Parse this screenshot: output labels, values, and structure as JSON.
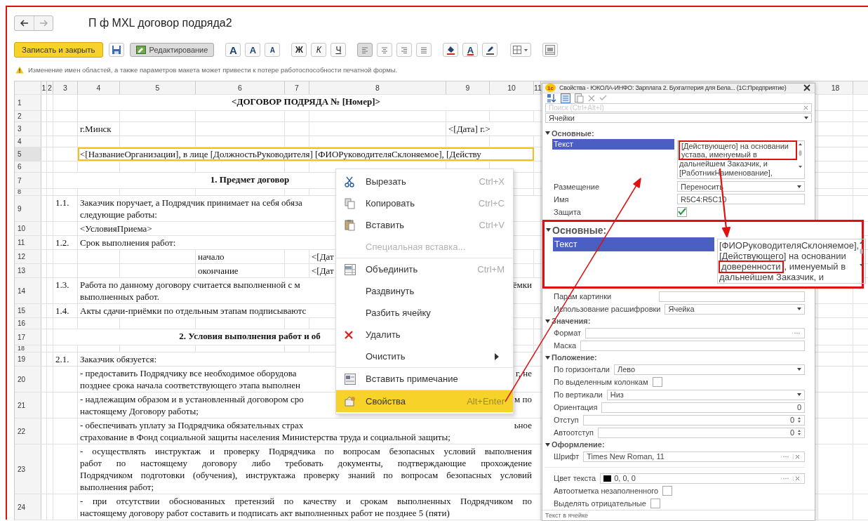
{
  "nav": {
    "back_enabled": true,
    "forward_enabled": false
  },
  "title": "П ф MXL договор подряда2",
  "toolbar": {
    "save_close": "Записать и закрыть",
    "edit": {
      "label": "Редактирование",
      "selected": true
    },
    "font_buttons": [
      {
        "kind": "font",
        "label": "A"
      },
      {
        "kind": "grow",
        "label": "A"
      },
      {
        "kind": "shrink",
        "label": "A"
      }
    ],
    "style_buttons": [
      {
        "kind": "bold",
        "label": "Ж"
      },
      {
        "kind": "italic",
        "label": "К"
      },
      {
        "kind": "underline",
        "label": "Ч"
      }
    ],
    "align_buttons": [
      {
        "kind": "left",
        "selected": true
      },
      {
        "kind": "center",
        "selected": false
      },
      {
        "kind": "right",
        "selected": false
      },
      {
        "kind": "justify",
        "selected": false
      }
    ],
    "color_buttons": [
      {
        "kind": "fill"
      },
      {
        "kind": "text_color",
        "label": "A"
      },
      {
        "kind": "highlight"
      }
    ]
  },
  "warning": "Изменение имен областей, а также параметров макета может привести к потере работоспособности печатной формы.",
  "sheet": {
    "columns": [
      {
        "label": "1"
      },
      {
        "label": "2"
      },
      {
        "label": "3"
      },
      {
        "label": "4"
      },
      {
        "label": "5"
      },
      {
        "label": "6"
      },
      {
        "label": "7"
      },
      {
        "label": "8"
      },
      {
        "label": "9"
      },
      {
        "label": "10"
      },
      {
        "label": "11"
      },
      {
        "label": "18"
      }
    ],
    "rows": [
      {
        "number": "1",
        "kind": "title",
        "selected": false,
        "text": "<ДОГОВОР ПОДРЯДА № [Номер]>"
      },
      {
        "number": "2",
        "kind": "empty",
        "selected": false
      },
      {
        "number": "3",
        "kind": "place_date",
        "selected": false,
        "left": "г.Минск",
        "right": "<[Дата] г.>"
      },
      {
        "number": "4",
        "kind": "empty",
        "selected": false
      },
      {
        "number": "5",
        "kind": "text",
        "selected": true,
        "lines": [
          {
            "text": "<[НазваниеОрганизации], в лице [ДолжностьРуководителя] [ФИОРуководителяСклоняемое], [Действу"
          }
        ]
      },
      {
        "number": "6",
        "kind": "empty",
        "selected": false
      },
      {
        "number": "7",
        "kind": "heading",
        "selected": false,
        "text": "1. Предмет договор"
      },
      {
        "number": "8",
        "kind": "spacer",
        "selected": false
      },
      {
        "number": "9",
        "kind": "clause",
        "selected": false,
        "index": "1.1.",
        "lines": [
          {
            "text": "Заказчик поручает, а Подрядчик принимает на себя обяза"
          },
          {
            "text": "следующие работы:"
          }
        ]
      },
      {
        "number": "10",
        "kind": "text",
        "selected": false,
        "lines": [
          {
            "text": "<УсловияПриема>"
          }
        ]
      },
      {
        "number": "11",
        "kind": "clause",
        "selected": false,
        "index": "1.2.",
        "lines": [
          {
            "text": "Срок выполнения работ:"
          }
        ]
      },
      {
        "number": "12",
        "kind": "term",
        "selected": false,
        "label": "начало",
        "value": "<[Дат"
      },
      {
        "number": "13",
        "kind": "term",
        "selected": false,
        "label": "окончание",
        "value": "<[Дат"
      },
      {
        "number": "14",
        "kind": "clause",
        "selected": false,
        "index": "1.3.",
        "lines": [
          {
            "text": "Работа по данному договору считается выполненной с м",
            "tail": "ёмки"
          },
          {
            "text": "выполненных работ."
          }
        ]
      },
      {
        "number": "15",
        "kind": "clause",
        "selected": false,
        "index": "1.4.",
        "lines": [
          {
            "text": "Акты сдачи-приёмки по отдельным этапам подписываютс"
          }
        ]
      },
      {
        "number": "16",
        "kind": "empty",
        "selected": false
      },
      {
        "number": "17",
        "kind": "heading",
        "selected": false,
        "text": "2. Условия выполнения работ и об"
      },
      {
        "number": "18",
        "kind": "spacer",
        "selected": false
      },
      {
        "number": "19",
        "kind": "clause",
        "selected": false,
        "index": "2.1.",
        "lines": [
          {
            "text": "Заказчик обязуется:"
          }
        ]
      },
      {
        "number": "20",
        "kind": "text",
        "selected": false,
        "lines": [
          {
            "text": "- предоставить Подрядчику все необходимое оборудова",
            "tail": "г, не"
          },
          {
            "text": "позднее срока  начала соответствующего этапа выполнен"
          }
        ]
      },
      {
        "number": "21",
        "kind": "text",
        "selected": false,
        "lines": [
          {
            "text": "-  надлежащим образом и в установленный договором сро",
            "tail": "м по"
          },
          {
            "text": "настоящему Договору работы;"
          }
        ]
      },
      {
        "number": "22",
        "kind": "text",
        "selected": false,
        "lines": [
          {
            "text": "- обеспечивать уплату за Подрядчика обязательных страх",
            "tail": "ьное"
          },
          {
            "text": "страхование в Фонд социальной защиты населения Министерства труда и социальной защиты;"
          }
        ]
      },
      {
        "number": "23",
        "kind": "paragraph",
        "selected": false,
        "lines": [
          {
            "text": "- осуществлять инструктаж и проверку Подрядчика по вопросам безопасных условий выполнения"
          },
          {
            "text": "работ по настоящему договору либо требовать документы, подтверждающие прохождение"
          },
          {
            "text": "Подрядчиком подготовки (обучения), инструктажа проверку знаний по вопросам безопасных условий"
          },
          {
            "text": "выполнения работ;"
          }
        ]
      },
      {
        "number": "24",
        "kind": "paragraph",
        "selected": false,
        "lines": [
          {
            "text": "- при отсутствии обоснованных претензий по качеству и срокам выполненных Подрядчиком по"
          },
          {
            "text": "настоящему договору работ составить и подписать акт выполненных работ не позднее 5 (пяти)"
          }
        ]
      }
    ]
  },
  "context_menu": [
    {
      "kind": "cut",
      "label": "Вырезать",
      "shortcut": "Ctrl+X",
      "disabled": false,
      "selected": false,
      "separator_before": false,
      "submenu": false
    },
    {
      "kind": "copy",
      "label": "Копировать",
      "shortcut": "Ctrl+C",
      "disabled": false,
      "selected": false,
      "separator_before": false,
      "submenu": false
    },
    {
      "kind": "paste",
      "label": "Вставить",
      "shortcut": "Ctrl+V",
      "disabled": false,
      "selected": false,
      "separator_before": false,
      "submenu": false
    },
    {
      "kind": "plain",
      "label": "Специальная вставка...",
      "disabled": true,
      "selected": false,
      "separator_before": false,
      "submenu": false
    },
    {
      "kind": "merge",
      "label": "Объединить",
      "shortcut": "Ctrl+M",
      "disabled": false,
      "selected": false,
      "separator_before": true,
      "submenu": false
    },
    {
      "kind": "plain",
      "label": "Раздвинуть",
      "disabled": false,
      "selected": false,
      "separator_before": false,
      "submenu": false
    },
    {
      "kind": "plain",
      "label": "Разбить ячейку",
      "disabled": false,
      "selected": false,
      "separator_before": false,
      "submenu": false
    },
    {
      "kind": "delete",
      "label": "Удалить",
      "disabled": false,
      "selected": false,
      "separator_before": false,
      "submenu": false
    },
    {
      "kind": "plain",
      "label": "Очистить",
      "disabled": false,
      "selected": false,
      "separator_before": false,
      "submenu": true
    },
    {
      "kind": "note",
      "label": "Вставить примечание",
      "disabled": false,
      "selected": false,
      "separator_before": true,
      "submenu": false
    },
    {
      "kind": "properties",
      "label": "Свойства",
      "shortcut": "Alt+Enter",
      "disabled": false,
      "selected": true,
      "separator_before": true,
      "submenu": false
    }
  ],
  "properties": {
    "logo": "1с",
    "title": "Свойства - ЮКОЛА-ИНФО: Зарплата 2. Бухгалтерия для Бела... (1С:Предприятие)",
    "search_placeholder": "Поиск (Ctrl+Alt+I)",
    "object": "Ячейки",
    "blocks": [
      {
        "kind": "section",
        "title": "Основные:",
        "expanded": true,
        "rows": [
          {
            "kind": "text",
            "label": "Текст",
            "selected": true,
            "parts": [
              {
                "text": "[Действующего] на основании устава, именуемый в",
                "highlighted": true
              },
              {
                "text": " дальнейшем Заказчик, и [РаботникНаименование],",
                "highlighted": false
              }
            ]
          },
          {
            "kind": "select",
            "label": "Размещение",
            "value": "Переносить"
          },
          {
            "kind": "input",
            "label": "Имя",
            "value": "R5C4:R5C10"
          },
          {
            "kind": "checkbox",
            "label": "Защита",
            "checked": true
          }
        ]
      },
      {
        "kind": "callout",
        "title": "Основные:",
        "expanded": true,
        "rows": [
          {
            "kind": "text",
            "label": "Текст",
            "selected": true,
            "parts": [
              {
                "text": "[ФИОРуководителяСклоняемое], [Действующего] на основании ",
                "highlighted": false
              },
              {
                "text": "доверенности",
                "highlighted": true
              },
              {
                "text": ", именуемый в дальнейшем Заказчик, и",
                "highlighted": false
              }
            ]
          }
        ]
      },
      {
        "kind": "rows",
        "rows": [
          {
            "kind": "input",
            "label": "Парам картинки"
          },
          {
            "kind": "select",
            "label": "Использование расшифровки",
            "value": "Ячейка"
          }
        ]
      },
      {
        "kind": "section",
        "title": "Значения:",
        "expanded": true,
        "rows": [
          {
            "kind": "format",
            "label": "Формат"
          },
          {
            "kind": "input",
            "label": "Маска"
          }
        ]
      },
      {
        "kind": "section",
        "title": "Положение:",
        "expanded": true,
        "rows": [
          {
            "kind": "select",
            "label": "По горизонтали",
            "value": "Лево"
          },
          {
            "kind": "checkbox",
            "label": "По выделенным колонкам",
            "checked": false
          },
          {
            "kind": "select",
            "label": "По вертикали",
            "value": "Низ"
          },
          {
            "kind": "number",
            "label": "Ориентация",
            "value": "0"
          },
          {
            "kind": "spin",
            "label": "Отступ",
            "value": "0"
          },
          {
            "kind": "spin",
            "label": "Автоотступ",
            "value": "0"
          }
        ]
      },
      {
        "kind": "section",
        "title": "Оформление:",
        "expanded": true,
        "rows": [
          {
            "kind": "font",
            "label": "Шрифт",
            "value": "Times New Roman, 11"
          },
          {
            "kind": "color",
            "label": "Цвет текста",
            "value": "0, 0, 0",
            "color": "#000000"
          },
          {
            "kind": "checkbox",
            "label": "Автоотметка незаполненного",
            "checked": false
          },
          {
            "kind": "checkbox",
            "label": "Выделять отрицательные",
            "checked": false
          }
        ]
      }
    ],
    "footer": "Текст в ячейке"
  }
}
